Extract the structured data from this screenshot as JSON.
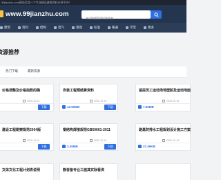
{
  "topbar": {
    "text": "99jianzhu.com建站打造一个专业精品建筑资料分享平台！"
  },
  "header": {
    "logo_text": "www.99jianzhu.com",
    "search_placeholder": "合适地搜索资料和作者"
  },
  "nav": [
    {
      "label": "建筑"
    },
    {
      "label": "资料"
    },
    {
      "label": "结构"
    },
    {
      "label": "电气"
    },
    {
      "label": "景观"
    },
    {
      "label": "标准"
    },
    {
      "label": "暖通"
    },
    {
      "label": "学堂"
    },
    {
      "label": "更多"
    }
  ],
  "section": {
    "title": "资源推荐"
  },
  "tabs": [
    {
      "label": "热门下载"
    },
    {
      "label": "最新资源"
    }
  ],
  "cards": [
    {
      "title": "价格调整及价格指数的确",
      "date": "2020-10-14",
      "size": "",
      "button": "下载"
    },
    {
      "title": "安装工程预结算资料",
      "date": "2020-10-14",
      "size": "12.50MB",
      "button": "下载"
    },
    {
      "title": "基层员工运动场地塑胶及运动地面",
      "date": "2020-10-14",
      "size": "7.65MB",
      "button": ""
    },
    {
      "title": "建设工程勘察规范2004版",
      "date": "2020-10-14",
      "size": "",
      "button": "下载"
    },
    {
      "title": "钢结构焊接规范GB50661-2011",
      "date": "2020-10-14",
      "size": "2.45MB",
      "button": "下载"
    },
    {
      "title": "路基防排水工程规划设计施工方案",
      "date": "2020-10-14",
      "size": "27.49KB",
      "button": ""
    },
    {
      "title": "文体文化工程计划表说明",
      "date": "",
      "size": "",
      "button": ""
    },
    {
      "title": "静音备专业三面其实际看资",
      "date": "",
      "size": "",
      "button": ""
    }
  ]
}
